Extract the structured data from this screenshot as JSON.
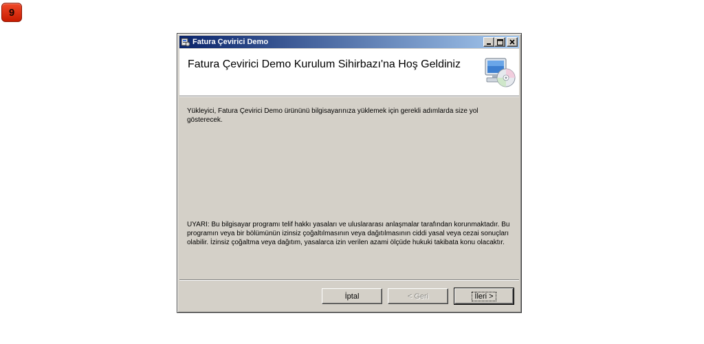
{
  "step_badge": {
    "number": "9"
  },
  "window": {
    "title": "Fatura Çevirici Demo",
    "buttons": {
      "minimize": "_",
      "maximize": "□",
      "close": "×"
    }
  },
  "header": {
    "title": "Fatura Çevirici Demo Kurulum Sihirbazı'na Hoş Geldiniz",
    "icon": "computer-cd-icon"
  },
  "body": {
    "intro": "Yükleyici, Fatura Çevirici Demo ürününü bilgisayarınıza yüklemek için gerekli adımlarda size yol gösterecek.",
    "warning": "UYARI: Bu bilgisayar programı telif hakkı yasaları ve uluslararası anlaşmalar tarafından korunmaktadır. Bu programın veya bir bölümünün izinsiz çoğaltılmasının veya dağıtılmasının ciddi yasal veya cezai sonuçları olabilir. İzinsiz çoğaltma veya dağıtım, yasalarca izin verilen azami ölçüde hukuki takibata konu olacaktır."
  },
  "footer": {
    "cancel_label": "İptal",
    "back_label": "< Geri",
    "next_label": "İleri >"
  }
}
